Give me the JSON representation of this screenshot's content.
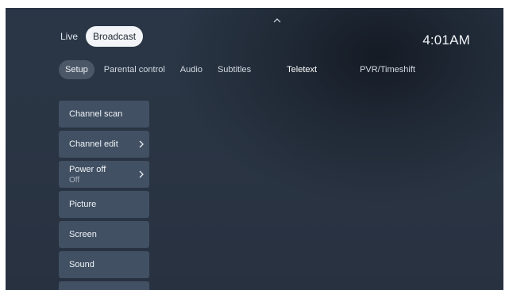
{
  "top": {
    "chevron_icon": "chevron-up-icon"
  },
  "mode_switch": {
    "live_label": "Live",
    "broadcast_label": "Broadcast",
    "selected": "Broadcast"
  },
  "clock": {
    "time": "4:01AM"
  },
  "tabs": [
    {
      "label": "Setup",
      "active": true
    },
    {
      "label": "Parental control",
      "active": false
    },
    {
      "label": "Audio",
      "active": false
    },
    {
      "label": "Subtitles",
      "active": false
    },
    {
      "label": "Teletext",
      "active": false
    },
    {
      "label": "PVR/Timeshift",
      "active": false
    }
  ],
  "menu": {
    "items": [
      {
        "label": "Channel scan",
        "value": "",
        "has_chevron": false
      },
      {
        "label": "Channel edit",
        "value": "",
        "has_chevron": true
      },
      {
        "label": "Power off",
        "value": "Off",
        "has_chevron": true
      },
      {
        "label": "Picture",
        "value": "",
        "has_chevron": false
      },
      {
        "label": "Screen",
        "value": "",
        "has_chevron": false
      },
      {
        "label": "Sound",
        "value": "",
        "has_chevron": false
      }
    ]
  },
  "colors": {
    "background": "#2a3646",
    "menu_item": "#415063",
    "active_tab": "#4b5767",
    "selected_pill": "#f2f4f7"
  }
}
